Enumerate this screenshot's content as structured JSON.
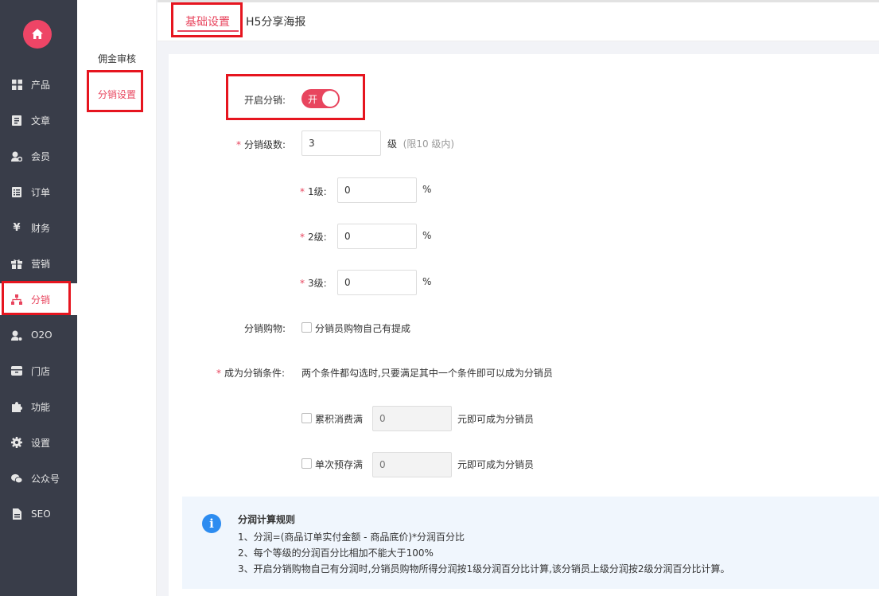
{
  "sidebar": {
    "logo_icon": "home-icon",
    "items": [
      {
        "label": "产品",
        "icon": "grid-icon"
      },
      {
        "label": "文章",
        "icon": "document-icon"
      },
      {
        "label": "会员",
        "icon": "member-icon"
      },
      {
        "label": "订单",
        "icon": "order-list-icon"
      },
      {
        "label": "财务",
        "icon": "yen-icon"
      },
      {
        "label": "营销",
        "icon": "gift-icon"
      },
      {
        "label": "分销",
        "icon": "sitemap-icon"
      },
      {
        "label": "O2O",
        "icon": "o2o-icon"
      },
      {
        "label": "门店",
        "icon": "store-icon"
      },
      {
        "label": "功能",
        "icon": "puzzle-icon"
      },
      {
        "label": "设置",
        "icon": "gear-icon"
      },
      {
        "label": "公众号",
        "icon": "wechat-icon"
      },
      {
        "label": "SEO",
        "icon": "seo-file-icon"
      }
    ],
    "active": "分销"
  },
  "submenu": {
    "items": [
      "佣金审核",
      "分销设置"
    ],
    "active": "分销设置"
  },
  "tabs": {
    "items": [
      "基础设置",
      "H5分享海报"
    ],
    "active": "基础设置"
  },
  "form": {
    "enable_label": "开启分销:",
    "enable_switch_text": "开",
    "enabled": true,
    "levels_label": "分销级数:",
    "levels_value": "3",
    "levels_unit": "级",
    "levels_hint": "(限10 级内)",
    "level_rates": [
      {
        "label": "1级:",
        "value": "0",
        "unit": "%"
      },
      {
        "label": "2级:",
        "value": "0",
        "unit": "%"
      },
      {
        "label": "3级:",
        "value": "0",
        "unit": "%"
      }
    ],
    "self_purchase_label": "分销购物:",
    "self_purchase_text": "分销员购物自己有提成",
    "condition_label": "成为分销条件:",
    "condition_hint": "两个条件都勾选时,只要满足其中一个条件即可以成为分销员",
    "conditions": [
      {
        "label": "累积消费满",
        "placeholder": "0",
        "suffix": "元即可成为分销员"
      },
      {
        "label": "单次预存满",
        "placeholder": "0",
        "suffix": "元即可成为分销员"
      }
    ]
  },
  "rules": {
    "title": "分润计算规则",
    "lines": [
      "1、分润=(商品订单实付金额 - 商品底价)*分润百分比",
      "2、每个等级的分润百分比相加不能大于100%",
      "3、开启分销购物自己有分润时,分销员购物所得分润按1级分润百分比计算,该分销员上级分润按2级分润百分比计算。"
    ]
  },
  "colors": {
    "accent": "#e8455e",
    "sidebar_bg": "#393d49",
    "highlight": "#e6151f",
    "info": "#2d8cf0"
  }
}
